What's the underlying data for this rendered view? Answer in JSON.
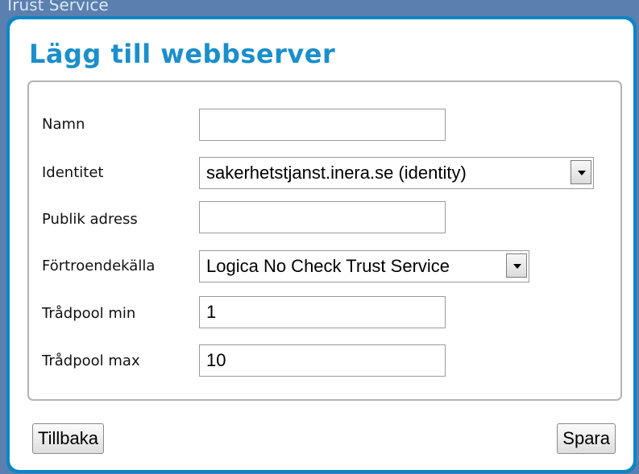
{
  "background_title": "Trust Service",
  "dialog": {
    "title": "Lägg till webbserver",
    "fields": {
      "name": {
        "label": "Namn",
        "value": ""
      },
      "identity": {
        "label": "Identitet",
        "value": "sakerhetstjanst.inera.se (identity)"
      },
      "public_addr": {
        "label": "Publik adress",
        "value": ""
      },
      "trust_src": {
        "label": "Förtroendekälla",
        "value": "Logica No Check Trust Service"
      },
      "pool_min": {
        "label": "Trådpool min",
        "value": "1"
      },
      "pool_max": {
        "label": "Trådpool max",
        "value": "10"
      }
    },
    "buttons": {
      "back": "Tillbaka",
      "save": "Spara"
    }
  },
  "icons": {
    "dropdown": "chevron-down-icon"
  },
  "colors": {
    "frame": "#0d86c4",
    "title": "#1a8fcb",
    "backdrop": "#5b7fae"
  }
}
